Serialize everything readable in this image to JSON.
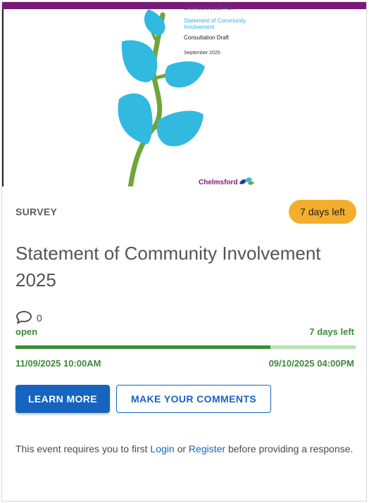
{
  "cover": {
    "top_text": "Chelmsford Local Plan",
    "doc_title": "Statement of Community Involvement",
    "doc_status": "Consultation Draft",
    "doc_date": "September 2025",
    "brand": "Chelmsford"
  },
  "card": {
    "type_label": "SURVEY",
    "days_badge": "7 days left",
    "title": "Statement of Community Involvement 2025",
    "comment_count": "0",
    "status": "open",
    "days_left": "7 days left",
    "progress_fraction": 0.75,
    "start_date": "11/09/2025 10:00AM",
    "end_date": "09/10/2025 04:00PM",
    "learn_more_label": "LEARN MORE",
    "comments_label": "MAKE YOUR COMMENTS",
    "notice_prefix": "This event requires you to first",
    "login_label": "Login",
    "notice_or": "or",
    "register_label": "Register",
    "notice_suffix": "before providing a response."
  },
  "colors": {
    "brand_purple": "#7a1a78",
    "leaf_blue": "#31b9e0",
    "stem_green": "#6fa53a",
    "badge_orange": "#f4ae2e",
    "status_green": "#3d8b38",
    "button_blue": "#1664c0"
  },
  "icons": [
    "speech-bubble-icon",
    "chelmsford-logo-icon"
  ]
}
